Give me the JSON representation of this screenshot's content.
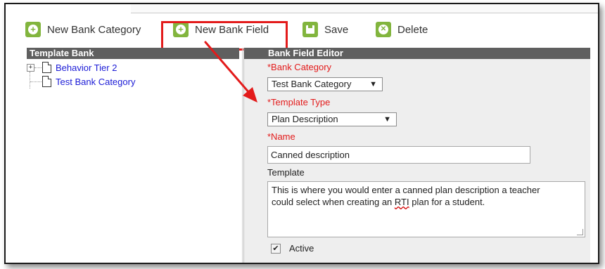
{
  "toolbar": {
    "new_bank_category": "New Bank Category",
    "new_bank_field": "New Bank Field",
    "save": "Save",
    "delete": "Delete"
  },
  "template_bank": {
    "header": "Template Bank",
    "items": [
      {
        "label": "Behavior Tier 2",
        "expandable": true
      },
      {
        "label": "Test Bank Category",
        "expandable": false
      }
    ]
  },
  "editor": {
    "header": "Bank Field Editor",
    "bank_category_label": "*Bank Category",
    "bank_category_value": "Test Bank Category",
    "template_type_label": "*Template Type",
    "template_type_value": "Plan Description",
    "name_label": "*Name",
    "name_value": "Canned description",
    "template_label": "Template",
    "template_text_line1": "This is where you would enter a canned plan description a teacher",
    "template_text_line2_pre": "could select when creating an ",
    "template_text_line2_rti": "RTI",
    "template_text_line2_post": " plan for a student.",
    "active_label": "Active",
    "active_checked": true
  },
  "colors": {
    "accent_green": "#82b53e",
    "highlight_red": "#e31b1b",
    "header_gray": "#5f5f5f",
    "link_blue": "#1a1ad6"
  },
  "icons": {
    "plus": "+",
    "delete": "✕",
    "dropdown": "▼",
    "check": "✔",
    "expander": "+"
  }
}
